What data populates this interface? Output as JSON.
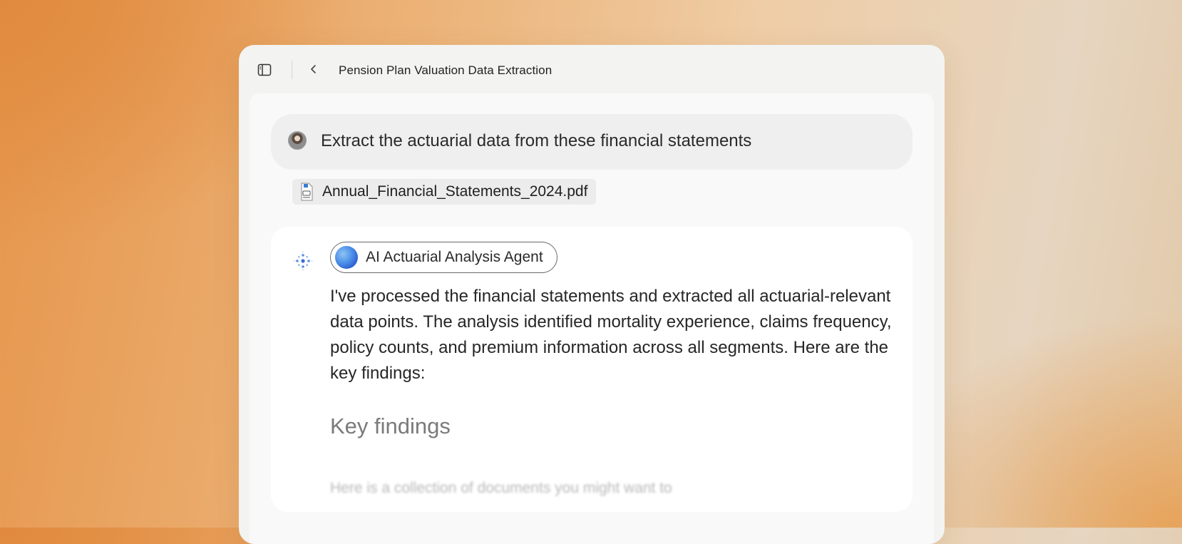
{
  "window": {
    "title": "Pension Plan Valuation Data Extraction"
  },
  "icons": {
    "sidebar_toggle": "sidebar-toggle-icon",
    "back": "chevron-left-icon",
    "attachment": "pdf-file-icon",
    "agent_status": "dotted-spinner-icon"
  },
  "user_message": {
    "text": "Extract the actuarial data from these financial statements",
    "attachment": "Annual_Financial_Statements_2024.pdf"
  },
  "agent": {
    "name": "AI Actuarial Analysis Agent",
    "response": "I've processed the financial statements and extracted all actuarial-relevant data points. The analysis identified mortality experience, claims frequency, policy counts, and premium information across all segments. Here are the key findings:",
    "section_heading": "Key findings",
    "faded_text": "Here is a collection of documents you might want to"
  },
  "colors": {
    "accent_blue": "#4a8ee8",
    "card_bg": "#ffffff",
    "window_bg": "#f3f3f2"
  }
}
